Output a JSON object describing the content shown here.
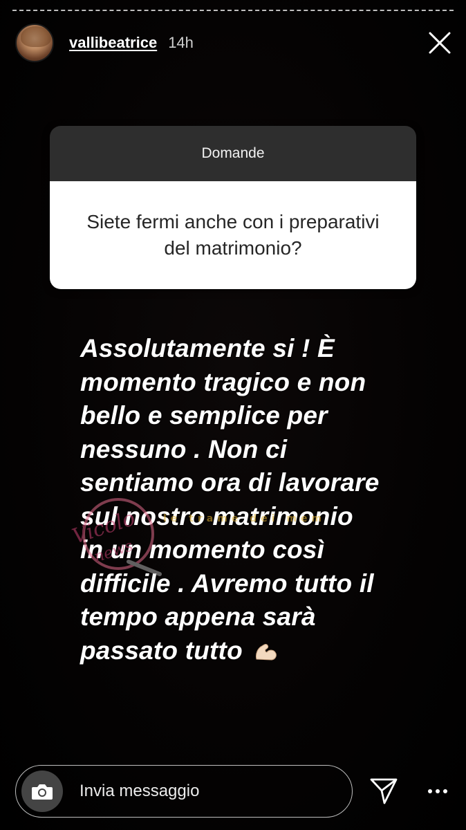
{
  "header": {
    "username": "vallibeatrice",
    "time": "14h",
    "close_icon": "close-icon",
    "avatar_icon": "profile-photo"
  },
  "question_card": {
    "title": "Domande",
    "question": "Siete fermi anche con i preparativi del matrimonio?",
    "header_color": "#2e2e2e",
    "body_color": "#ffffff"
  },
  "answer": {
    "lines": [
      "Assolutamente si ! È",
      "momento tragico e non",
      "bello e semplice per",
      "nessuno . Non ci",
      "sentiamo ora di lavorare",
      "sul nostro matrimonio",
      "in un momento così",
      "difficile . Avremo tutto il",
      "tempo appena sarà",
      "passato tutto"
    ],
    "emoji": "flexed-biceps-emoji"
  },
  "watermarks": {
    "left_logo": "Vicolo delle news",
    "center_text": "le trame dei mem"
  },
  "footer": {
    "message_placeholder": "Invia messaggio",
    "camera_icon": "camera-icon",
    "send_icon": "send-icon",
    "more_icon": "more-icon"
  }
}
